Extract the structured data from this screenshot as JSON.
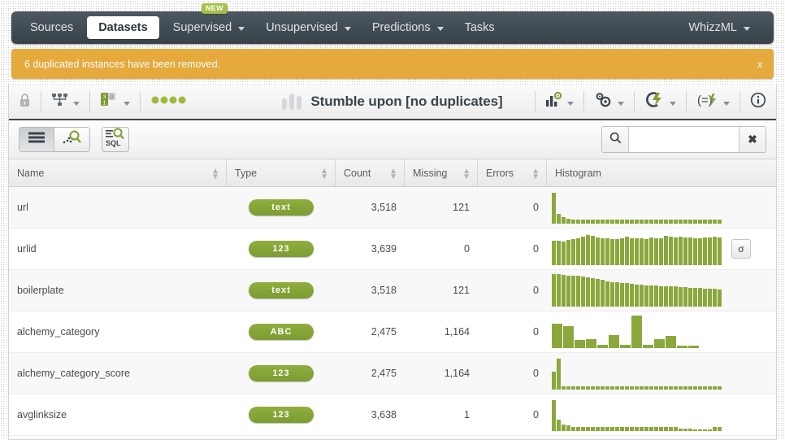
{
  "nav": {
    "items": [
      {
        "label": "Sources",
        "active": false,
        "caret": false,
        "badge": null
      },
      {
        "label": "Datasets",
        "active": true,
        "caret": false,
        "badge": null
      },
      {
        "label": "Supervised",
        "active": false,
        "caret": true,
        "badge": "NEW"
      },
      {
        "label": "Unsupervised",
        "active": false,
        "caret": true,
        "badge": null
      },
      {
        "label": "Predictions",
        "active": false,
        "caret": true,
        "badge": null
      },
      {
        "label": "Tasks",
        "active": false,
        "caret": false,
        "badge": null
      }
    ],
    "right": {
      "label": "WhizzML",
      "caret": true
    }
  },
  "alert": {
    "message": "6 duplicated instances have been removed.",
    "close_label": "x",
    "color": "#e5a93c"
  },
  "toolbar": {
    "left_icons": [
      {
        "name": "lock-icon",
        "label": ""
      },
      {
        "name": "share-tree-icon",
        "label": ""
      },
      {
        "name": "sampling-rate-icon",
        "label": ""
      },
      {
        "name": "status-dots-icon",
        "label": ""
      }
    ],
    "dataset_title": "Stumble upon [no duplicates]",
    "right_icons": [
      {
        "name": "chart-config-icon",
        "label": ""
      },
      {
        "name": "gears-icon",
        "label": ""
      },
      {
        "name": "flash-model-icon",
        "label": ""
      },
      {
        "name": "script-flash-icon",
        "label": ""
      },
      {
        "name": "info-icon",
        "label": ""
      }
    ]
  },
  "subbar": {
    "views": [
      {
        "name": "list-view-button",
        "selected": true
      },
      {
        "name": "scatter-view-button",
        "selected": false
      }
    ],
    "sql_button_label": "SQL",
    "search": {
      "value": "",
      "placeholder": "",
      "clear_label": "✖"
    }
  },
  "table": {
    "columns": [
      "Name",
      "Type",
      "Count",
      "Missing",
      "Errors",
      "Histogram"
    ],
    "rows": [
      {
        "name": "url",
        "type": "text",
        "count": "3,518",
        "missing": "121",
        "errors": "0",
        "has_sigma": false,
        "hist": [
          38,
          12,
          8,
          6,
          5,
          5,
          5,
          5,
          5,
          5,
          5,
          5,
          5,
          5,
          5,
          5,
          5,
          5,
          5,
          5,
          5,
          5,
          5,
          5,
          5,
          5,
          5,
          5,
          5,
          5,
          5,
          5,
          5,
          5,
          5
        ]
      },
      {
        "name": "urlid",
        "type": "123",
        "count": "3,639",
        "missing": "0",
        "errors": "0",
        "has_sigma": true,
        "hist": [
          30,
          30,
          29,
          31,
          32,
          33,
          35,
          37,
          36,
          34,
          33,
          33,
          32,
          32,
          33,
          35,
          33,
          33,
          33,
          32,
          34,
          33,
          33,
          36,
          35,
          34,
          35,
          34,
          34,
          33,
          33,
          34,
          34,
          35,
          34
        ]
      },
      {
        "name": "boilerplate",
        "type": "text",
        "count": "3,518",
        "missing": "121",
        "errors": "0",
        "has_sigma": false,
        "hist": [
          40,
          40,
          39,
          38,
          38,
          38,
          37,
          36,
          35,
          34,
          33,
          31,
          30,
          30,
          29,
          29,
          28,
          27,
          27,
          26,
          26,
          26,
          25,
          25,
          25,
          25,
          24,
          24,
          23,
          23,
          23,
          22,
          22,
          22,
          21
        ]
      },
      {
        "name": "alchemy_category",
        "type": "ABC",
        "count": "2,475",
        "missing": "1,164",
        "errors": "0",
        "has_sigma": false,
        "hist": [
          30,
          27,
          10,
          11,
          4,
          16,
          4,
          40,
          4,
          11,
          15,
          3,
          3
        ]
      },
      {
        "name": "alchemy_category_score",
        "type": "123",
        "count": "2,475",
        "missing": "1,164",
        "errors": "0",
        "has_sigma": false,
        "hist": [
          22,
          38,
          4,
          4,
          4,
          4,
          4,
          4,
          4,
          4,
          4,
          4,
          4,
          4,
          4,
          4,
          4,
          4,
          4,
          4,
          4,
          4,
          4,
          4,
          4,
          4,
          4,
          4,
          4,
          4,
          4,
          4,
          4,
          4,
          4
        ]
      },
      {
        "name": "avglinksize",
        "type": "123",
        "count": "3,638",
        "missing": "1",
        "errors": "0",
        "has_sigma": false,
        "hist": [
          38,
          14,
          8,
          7,
          5,
          5,
          5,
          5,
          5,
          5,
          5,
          5,
          5,
          5,
          5,
          5,
          5,
          5,
          5,
          5,
          5,
          5,
          5,
          5,
          5,
          5,
          3,
          3,
          3,
          2,
          2,
          2,
          2,
          5,
          5
        ]
      }
    ]
  },
  "colors": {
    "accent_green": "#8aa83c",
    "badge_green": "#8fae3d",
    "nav_dark": "#434d55",
    "alert_orange": "#e5a93c"
  }
}
